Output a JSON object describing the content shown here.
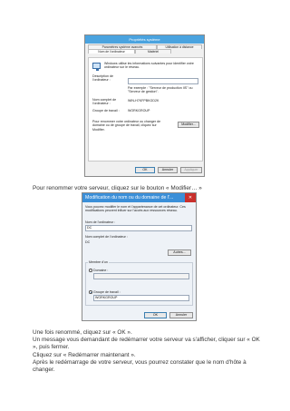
{
  "dialog1": {
    "title": "Propriétés système",
    "tabs": [
      "Paramètres système avancés",
      "Utilisation à distance",
      "Nom de l'ordinateur",
      "Matériel"
    ],
    "intro": "Windows utilise les informations suivantes pour identifier votre ordinateur sur le réseau.",
    "description_label": "Description de l'ordinateur :",
    "description_value": "",
    "example": "Par exemple : \"Serveur de production IIS\" ou \"Serveur de gestion\".",
    "fullname_label": "Nom complet de l'ordinateur :",
    "fullname_value": "WIN-H7KFPBKGD2K",
    "workgroup_label": "Groupe de travail :",
    "workgroup_value": "WORKGROUP",
    "rename_text": "Pour renommer votre ordinateur ou changer de domaine ou de groupe de travail, cliquez sur Modifier.",
    "modify_button": "Modifier...",
    "ok": "OK",
    "cancel": "Annuler",
    "apply": "Appliquer"
  },
  "caption1": "Pour renommer votre serveur, cliquez sur le bouton « Modifier… »",
  "dialog2": {
    "title": "Modification du nom ou du domaine de l'...",
    "intro": "Vous pouvez modifier le nom et l'appartenance de cet ordinateur. Ces modifications peuvent influer sur l'accès aux ressources réseau.",
    "name_label": "Nom de l'ordinateur :",
    "name_value": "DC",
    "fullname_label": "Nom complet de l'ordinateur :",
    "fullname_value": "DC",
    "more_button": "Autres...",
    "member_label": "Membre d'un",
    "domain_option": "Domaine :",
    "domain_value": "",
    "workgroup_option": "Groupe de travail :",
    "workgroup_value": "WORKGROUP",
    "ok": "OK",
    "cancel": "Annuler"
  },
  "instructions": [
    "Une fois renommé, cliquez sur « OK ».",
    "Un message vous demandant de redémarrer votre serveur va s'afficher, cliquer sur « OK », puis fermer.",
    "Cliquez sur « Redémarrer maintenant ».",
    "Après le redémarrage de votre serveur, vous pourrez constater que le nom d'hôte à changer."
  ]
}
